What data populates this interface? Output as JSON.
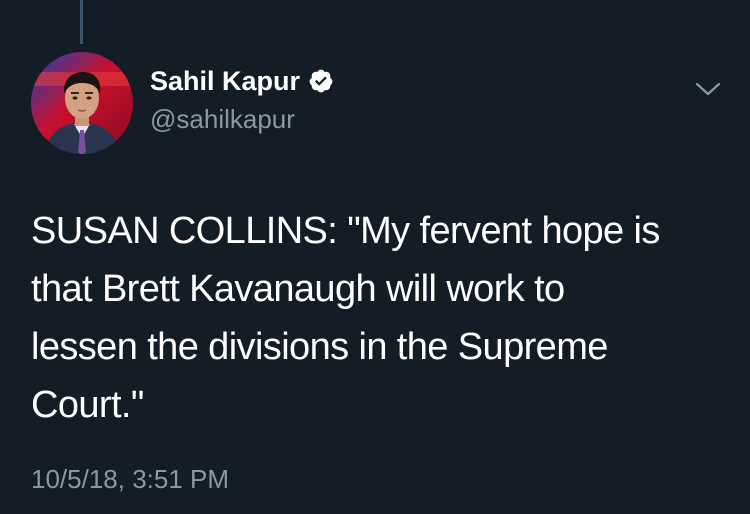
{
  "author": {
    "display_name": "Sahil Kapur",
    "handle": "@sahilkapur",
    "verified": true,
    "avatar_icon": "profile-photo"
  },
  "tweet": {
    "lines": [
      "SUSAN COLLINS: \"My fervent hope is",
      "that Brett Kavanaugh will work to",
      "lessen the divisions in the Supreme",
      "Court.\""
    ],
    "timestamp": "10/5/18, 3:51 PM"
  },
  "controls": {
    "menu_icon": "chevron-down-icon"
  },
  "colors": {
    "background": "#141d26",
    "primary_text": "#ffffff",
    "secondary_text": "#8899a6",
    "verified_badge": "#ffffff",
    "thread_line": "#3d5466"
  }
}
